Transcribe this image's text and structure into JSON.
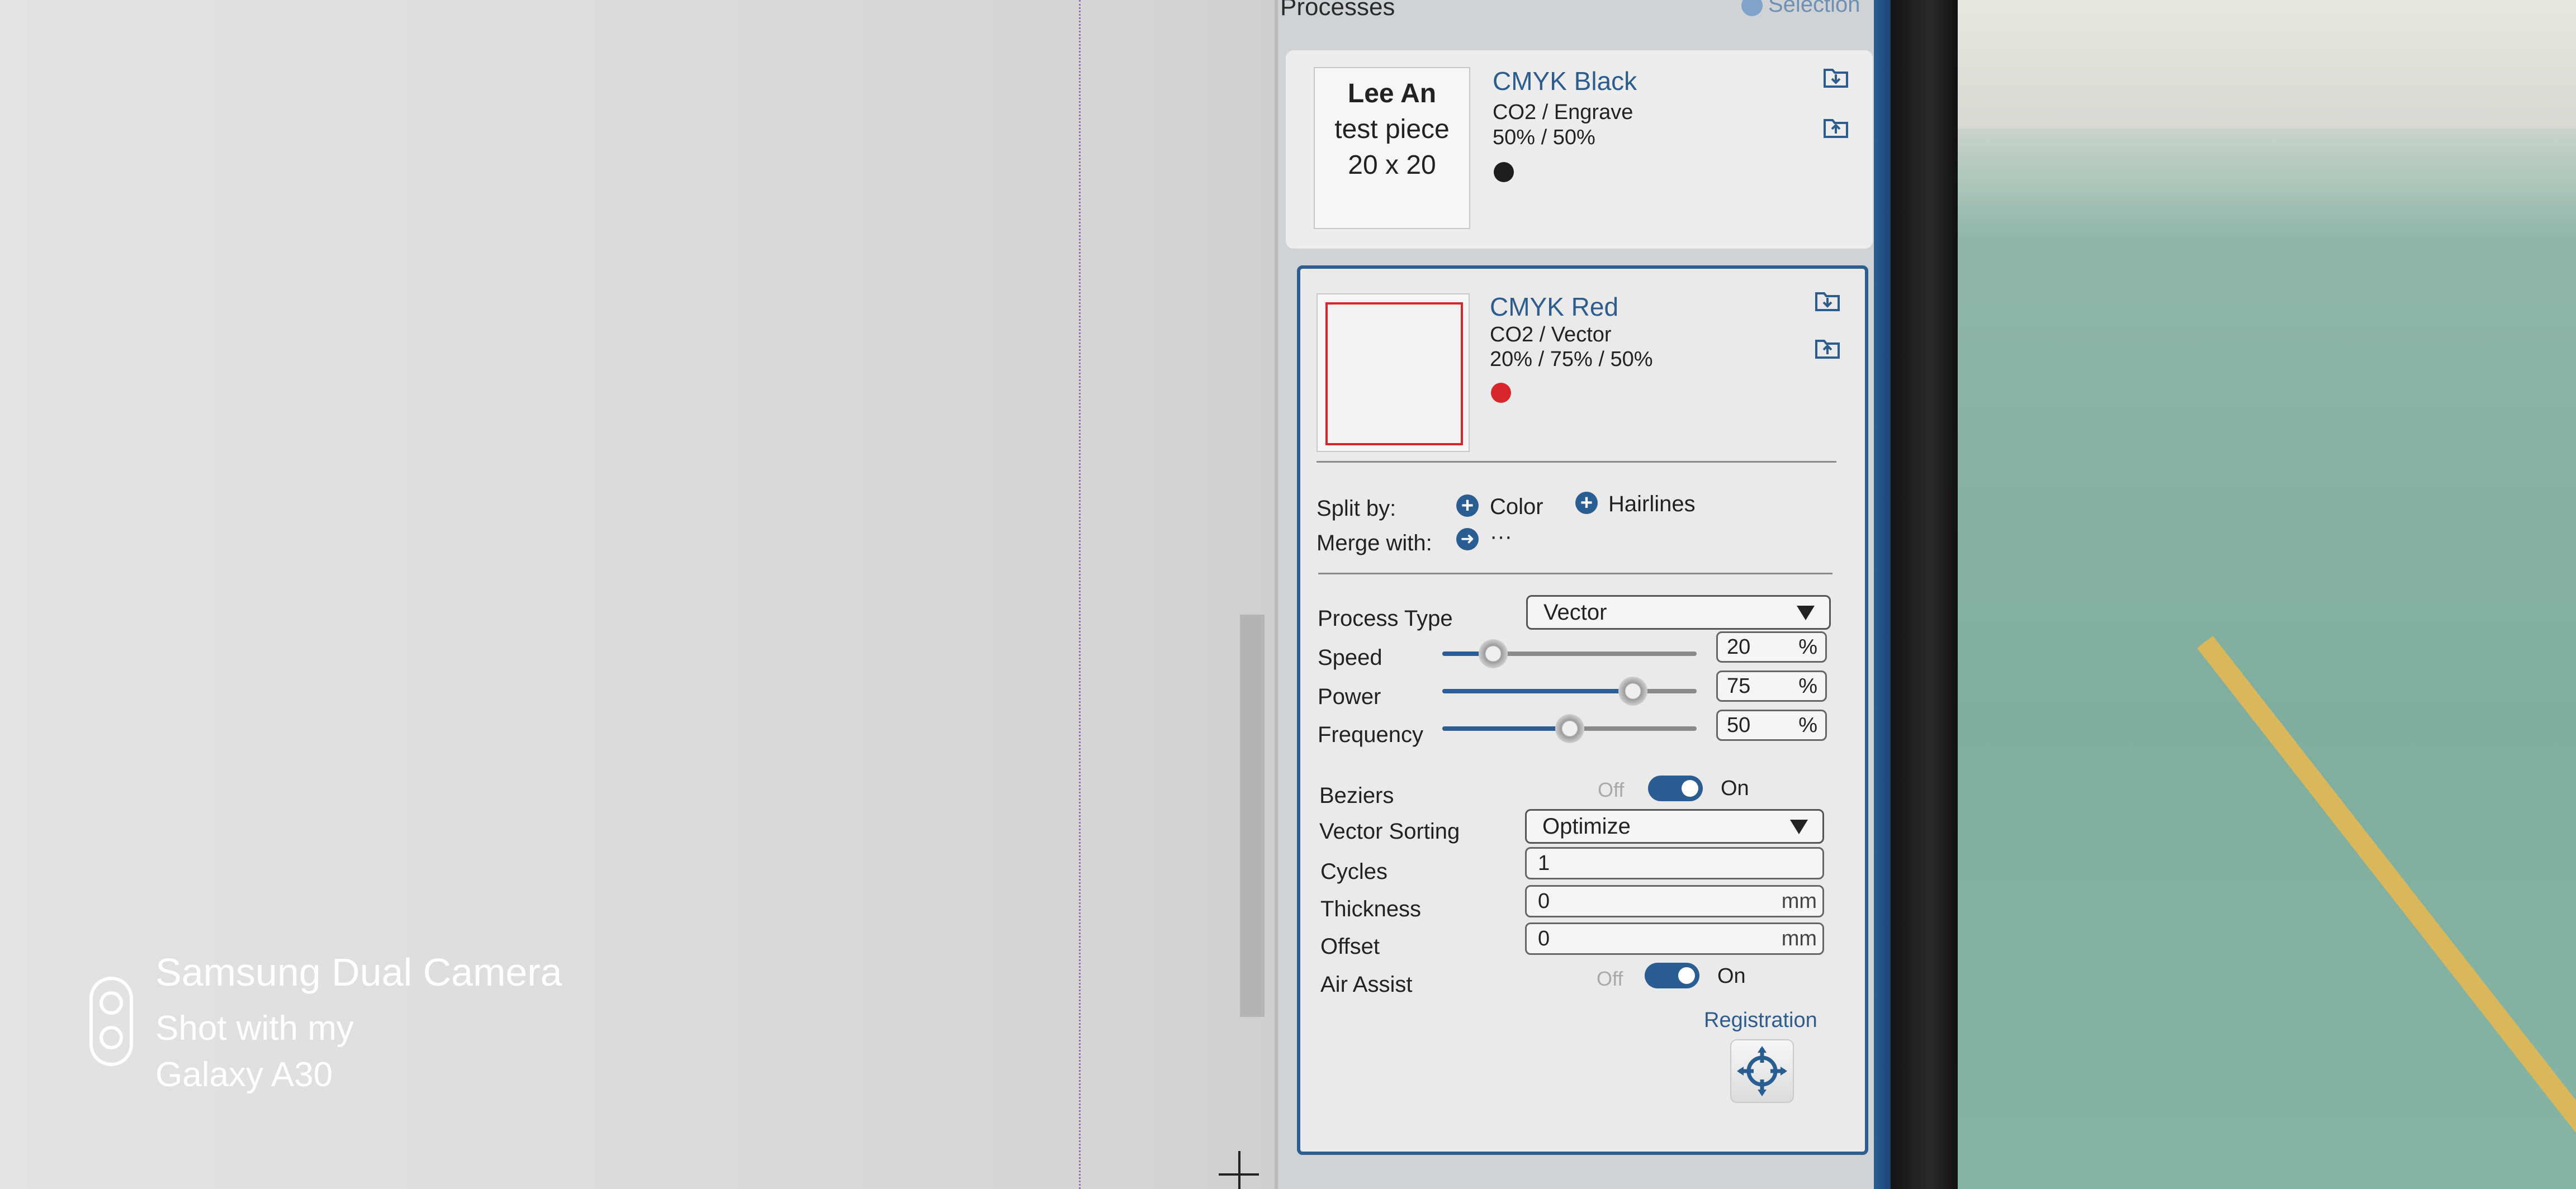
{
  "panel": {
    "title": "Processes",
    "selection_label": "Selection"
  },
  "process1": {
    "thumb_lines": [
      "Lee An",
      "test piece",
      "20 x 20"
    ],
    "name": "CMYK Black",
    "type": "CO2 / Engrave",
    "settings": "50% / 50%",
    "color": "#1e1e1e"
  },
  "process2": {
    "name": "CMYK Red",
    "type": "CO2 / Vector",
    "settings": "20% / 75% / 50%",
    "color": "#d8262d",
    "split_by_label": "Split by:",
    "split_color": "Color",
    "split_hairlines": "Hairlines",
    "merge_with_label": "Merge with:",
    "merge_value": "···",
    "process_type_label": "Process Type",
    "process_type_value": "Vector",
    "speed_label": "Speed",
    "speed_value": "20",
    "power_label": "Power",
    "power_value": "75",
    "frequency_label": "Frequency",
    "frequency_value": "50",
    "percent_unit": "%",
    "beziers_label": "Beziers",
    "vector_sorting_label": "Vector Sorting",
    "vector_sorting_value": "Optimize",
    "cycles_label": "Cycles",
    "cycles_value": "1",
    "thickness_label": "Thickness",
    "thickness_value": "0",
    "offset_label": "Offset",
    "offset_value": "0",
    "mm_unit": "mm",
    "air_assist_label": "Air Assist",
    "off_label": "Off",
    "on_label": "On",
    "registration_label": "Registration"
  },
  "sliders": {
    "speed": 0.2,
    "power": 0.75,
    "frequency": 0.5
  },
  "watermark": {
    "title": "Samsung Dual Camera",
    "line1": "Shot with my",
    "line2": "Galaxy A30"
  },
  "icons": [
    "selection-icon",
    "import-process-icon",
    "export-process-icon",
    "plus-icon",
    "arrow-right-icon",
    "caret-down-icon",
    "registration-crosshair-icon",
    "camera-logo-icon"
  ]
}
